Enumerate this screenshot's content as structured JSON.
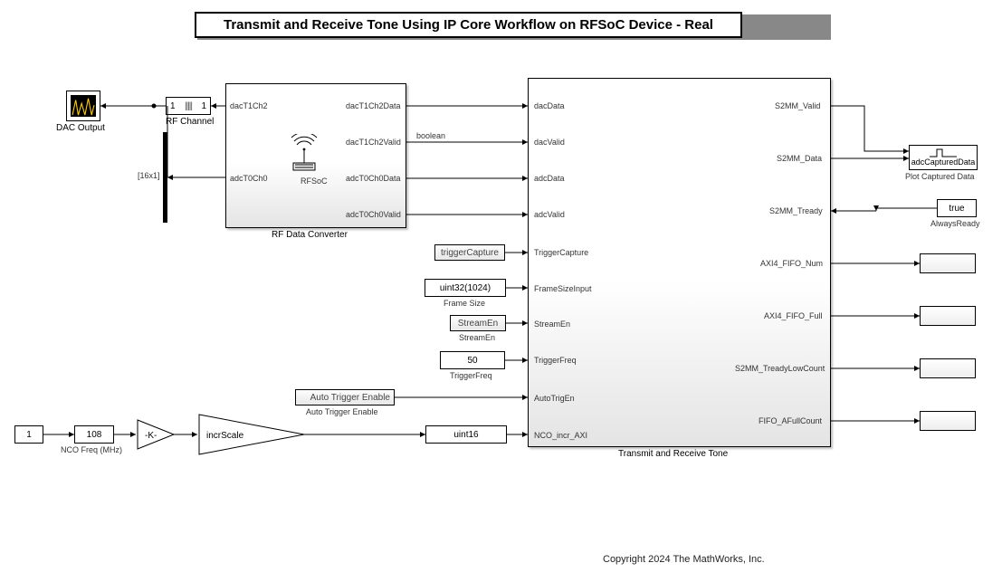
{
  "title": "Transmit and Receive Tone Using IP Core Workflow on RFSoC Device - Real",
  "dac_output_label": "DAC Output",
  "rf_channel_label": "RF Channel",
  "rf_channel_left": "1",
  "rf_channel_right": "1",
  "mux_label": "[16x1]",
  "rfdc": {
    "name": "RF Data Converter",
    "sub": "RFSoC",
    "in_top": "dacT1Ch2",
    "in_bot": "adcT0Ch0",
    "out1": "dacT1Ch2Data",
    "out2": "dacT1Ch2Valid",
    "sig2": "boolean",
    "out3": "adcT0Ch0Data",
    "out4": "adcT0Ch0Valid"
  },
  "triggerCapture": {
    "btn": "triggerCapture"
  },
  "frameSize": {
    "val": "uint32(1024)",
    "lbl": "Frame Size"
  },
  "streamEn": {
    "btn": "StreamEn",
    "lbl": "StreamEn"
  },
  "triggerFreq": {
    "val": "50",
    "lbl": "TriggerFreq"
  },
  "autoTrig": {
    "btn": "Auto Trigger Enable",
    "lbl": "Auto Trigger Enable"
  },
  "nco": {
    "const": "1",
    "freq": "108",
    "freq_lbl": "NCO Freq (MHz)",
    "gain_k": "-K-",
    "gain_name": "incrScale",
    "dtc": "uint16"
  },
  "main": {
    "name": "Transmit and Receive Tone",
    "in": {
      "dacData": "dacData",
      "dacValid": "dacValid",
      "adcData": "adcData",
      "adcValid": "adcValid",
      "TriggerCapture": "TriggerCapture",
      "FrameSizeInput": "FrameSizeInput",
      "StreamEn": "StreamEn",
      "TriggerFreq": "TriggerFreq",
      "AutoTrigEn": "AutoTrigEn",
      "NCO_incr_AXI": "NCO_incr_AXI"
    },
    "out": {
      "S2MM_Valid": "S2MM_Valid",
      "S2MM_Data": "S2MM_Data",
      "S2MM_Tready": "S2MM_Tready",
      "AXI4_FIFO_Num": "AXI4_FIFO_Num",
      "AXI4_FIFO_Full": "AXI4_FIFO_Full",
      "S2MM_TreadyLowCount": "S2MM_TreadyLowCount",
      "FIFO_AFullCount": "FIFO_AFullCount"
    }
  },
  "plot": {
    "name": "Plot Captured Data",
    "port": "adcCapturedData"
  },
  "alwaysReady": {
    "val": "true",
    "lbl": "AlwaysReady"
  },
  "copyright": "Copyright 2024 The MathWorks, Inc."
}
